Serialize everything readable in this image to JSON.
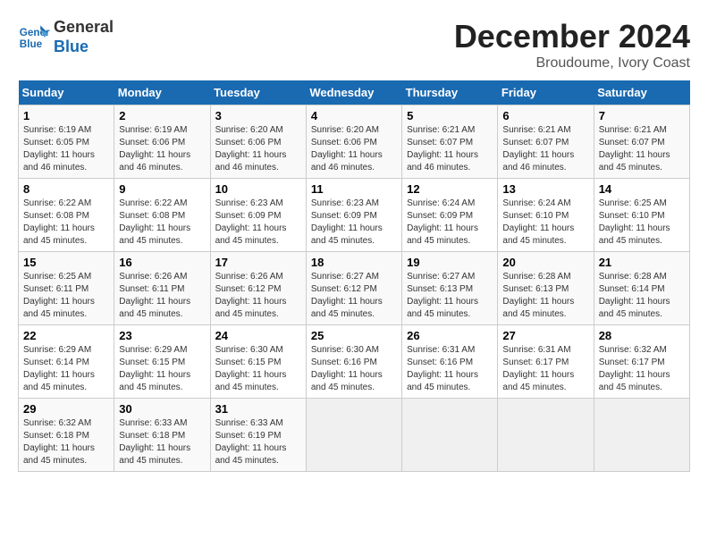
{
  "logo": {
    "line1": "General",
    "line2": "Blue"
  },
  "title": "December 2024",
  "subtitle": "Broudoume, Ivory Coast",
  "days_of_week": [
    "Sunday",
    "Monday",
    "Tuesday",
    "Wednesday",
    "Thursday",
    "Friday",
    "Saturday"
  ],
  "weeks": [
    [
      {
        "day": "1",
        "info": "Sunrise: 6:19 AM\nSunset: 6:05 PM\nDaylight: 11 hours\nand 46 minutes."
      },
      {
        "day": "2",
        "info": "Sunrise: 6:19 AM\nSunset: 6:06 PM\nDaylight: 11 hours\nand 46 minutes."
      },
      {
        "day": "3",
        "info": "Sunrise: 6:20 AM\nSunset: 6:06 PM\nDaylight: 11 hours\nand 46 minutes."
      },
      {
        "day": "4",
        "info": "Sunrise: 6:20 AM\nSunset: 6:06 PM\nDaylight: 11 hours\nand 46 minutes."
      },
      {
        "day": "5",
        "info": "Sunrise: 6:21 AM\nSunset: 6:07 PM\nDaylight: 11 hours\nand 46 minutes."
      },
      {
        "day": "6",
        "info": "Sunrise: 6:21 AM\nSunset: 6:07 PM\nDaylight: 11 hours\nand 46 minutes."
      },
      {
        "day": "7",
        "info": "Sunrise: 6:21 AM\nSunset: 6:07 PM\nDaylight: 11 hours\nand 45 minutes."
      }
    ],
    [
      {
        "day": "8",
        "info": "Sunrise: 6:22 AM\nSunset: 6:08 PM\nDaylight: 11 hours\nand 45 minutes."
      },
      {
        "day": "9",
        "info": "Sunrise: 6:22 AM\nSunset: 6:08 PM\nDaylight: 11 hours\nand 45 minutes."
      },
      {
        "day": "10",
        "info": "Sunrise: 6:23 AM\nSunset: 6:09 PM\nDaylight: 11 hours\nand 45 minutes."
      },
      {
        "day": "11",
        "info": "Sunrise: 6:23 AM\nSunset: 6:09 PM\nDaylight: 11 hours\nand 45 minutes."
      },
      {
        "day": "12",
        "info": "Sunrise: 6:24 AM\nSunset: 6:09 PM\nDaylight: 11 hours\nand 45 minutes."
      },
      {
        "day": "13",
        "info": "Sunrise: 6:24 AM\nSunset: 6:10 PM\nDaylight: 11 hours\nand 45 minutes."
      },
      {
        "day": "14",
        "info": "Sunrise: 6:25 AM\nSunset: 6:10 PM\nDaylight: 11 hours\nand 45 minutes."
      }
    ],
    [
      {
        "day": "15",
        "info": "Sunrise: 6:25 AM\nSunset: 6:11 PM\nDaylight: 11 hours\nand 45 minutes."
      },
      {
        "day": "16",
        "info": "Sunrise: 6:26 AM\nSunset: 6:11 PM\nDaylight: 11 hours\nand 45 minutes."
      },
      {
        "day": "17",
        "info": "Sunrise: 6:26 AM\nSunset: 6:12 PM\nDaylight: 11 hours\nand 45 minutes."
      },
      {
        "day": "18",
        "info": "Sunrise: 6:27 AM\nSunset: 6:12 PM\nDaylight: 11 hours\nand 45 minutes."
      },
      {
        "day": "19",
        "info": "Sunrise: 6:27 AM\nSunset: 6:13 PM\nDaylight: 11 hours\nand 45 minutes."
      },
      {
        "day": "20",
        "info": "Sunrise: 6:28 AM\nSunset: 6:13 PM\nDaylight: 11 hours\nand 45 minutes."
      },
      {
        "day": "21",
        "info": "Sunrise: 6:28 AM\nSunset: 6:14 PM\nDaylight: 11 hours\nand 45 minutes."
      }
    ],
    [
      {
        "day": "22",
        "info": "Sunrise: 6:29 AM\nSunset: 6:14 PM\nDaylight: 11 hours\nand 45 minutes."
      },
      {
        "day": "23",
        "info": "Sunrise: 6:29 AM\nSunset: 6:15 PM\nDaylight: 11 hours\nand 45 minutes."
      },
      {
        "day": "24",
        "info": "Sunrise: 6:30 AM\nSunset: 6:15 PM\nDaylight: 11 hours\nand 45 minutes."
      },
      {
        "day": "25",
        "info": "Sunrise: 6:30 AM\nSunset: 6:16 PM\nDaylight: 11 hours\nand 45 minutes."
      },
      {
        "day": "26",
        "info": "Sunrise: 6:31 AM\nSunset: 6:16 PM\nDaylight: 11 hours\nand 45 minutes."
      },
      {
        "day": "27",
        "info": "Sunrise: 6:31 AM\nSunset: 6:17 PM\nDaylight: 11 hours\nand 45 minutes."
      },
      {
        "day": "28",
        "info": "Sunrise: 6:32 AM\nSunset: 6:17 PM\nDaylight: 11 hours\nand 45 minutes."
      }
    ],
    [
      {
        "day": "29",
        "info": "Sunrise: 6:32 AM\nSunset: 6:18 PM\nDaylight: 11 hours\nand 45 minutes."
      },
      {
        "day": "30",
        "info": "Sunrise: 6:33 AM\nSunset: 6:18 PM\nDaylight: 11 hours\nand 45 minutes."
      },
      {
        "day": "31",
        "info": "Sunrise: 6:33 AM\nSunset: 6:19 PM\nDaylight: 11 hours\nand 45 minutes."
      },
      {
        "day": "",
        "info": ""
      },
      {
        "day": "",
        "info": ""
      },
      {
        "day": "",
        "info": ""
      },
      {
        "day": "",
        "info": ""
      }
    ]
  ]
}
